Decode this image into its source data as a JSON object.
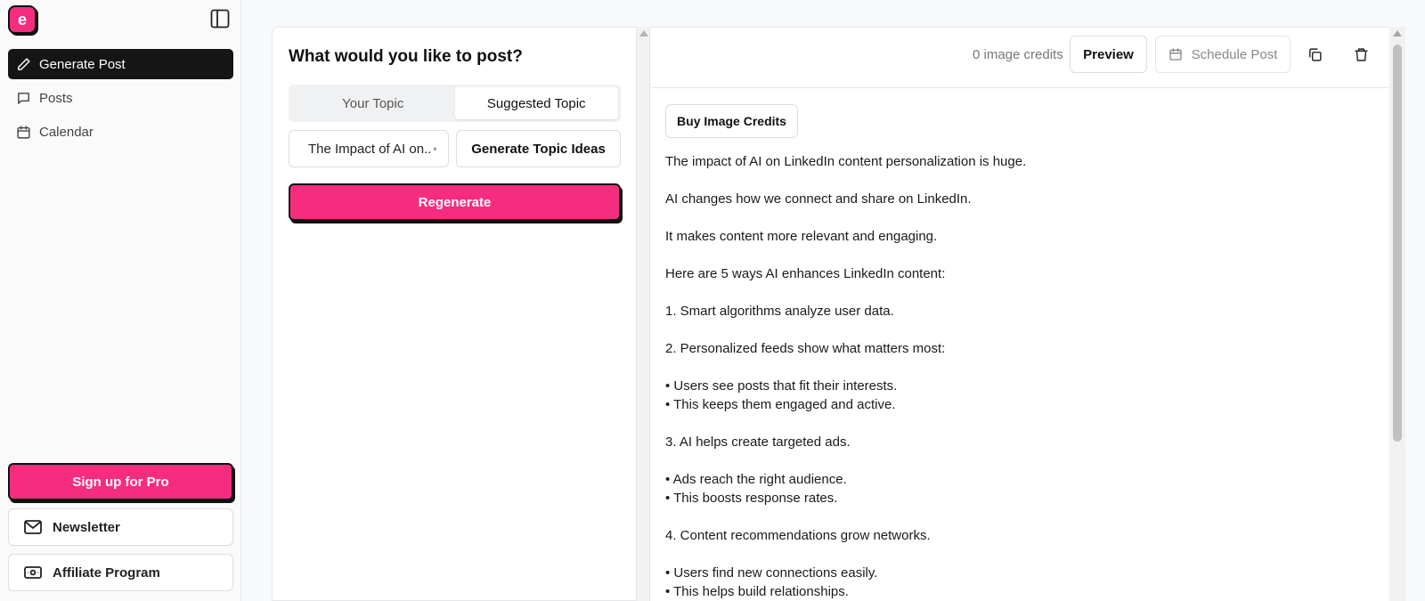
{
  "app": {
    "logo_letter": "e"
  },
  "sidebar": {
    "items": [
      {
        "label": "Generate Post",
        "icon": "pencil-icon",
        "active": true
      },
      {
        "label": "Posts",
        "icon": "message-square-icon",
        "active": false
      },
      {
        "label": "Calendar",
        "icon": "calendar-icon",
        "active": false
      }
    ],
    "pro_label": "Sign up for Pro",
    "newsletter_label": "Newsletter",
    "affiliate_label": "Affiliate Program"
  },
  "composer": {
    "title": "What would you like to post?",
    "tabs": [
      {
        "label": "Your Topic",
        "active": false
      },
      {
        "label": "Suggested Topic",
        "active": true
      }
    ],
    "selected_topic": "The Impact of AI on..",
    "generate_ideas_label": "Generate Topic Ideas",
    "regenerate_label": "Regenerate"
  },
  "editor": {
    "credits_text": "0 image credits",
    "preview_label": "Preview",
    "schedule_label": "Schedule Post",
    "buy_credits_label": "Buy Image Credits",
    "post_lines": [
      "The impact of AI on LinkedIn content personalization is huge.",
      "",
      "AI changes how we connect and share on LinkedIn.",
      "",
      "It makes content more relevant and engaging.",
      "",
      "Here are 5 ways AI enhances LinkedIn content:",
      "",
      "1. Smart algorithms analyze user data.",
      "",
      "2. Personalized feeds show what matters most:",
      "",
      "• Users see posts that fit their interests.",
      "• This keeps them engaged and active.",
      "",
      "3. AI helps create targeted ads.",
      "",
      "• Ads reach the right audience.",
      "• This boosts response rates.",
      "",
      "4. Content recommendations grow networks.",
      "",
      "• Users find new connections easily.",
      "• This helps build relationships."
    ]
  },
  "colors": {
    "accent": "#f62d7f",
    "active_nav": "#151515",
    "border": "#e6e7ea"
  }
}
